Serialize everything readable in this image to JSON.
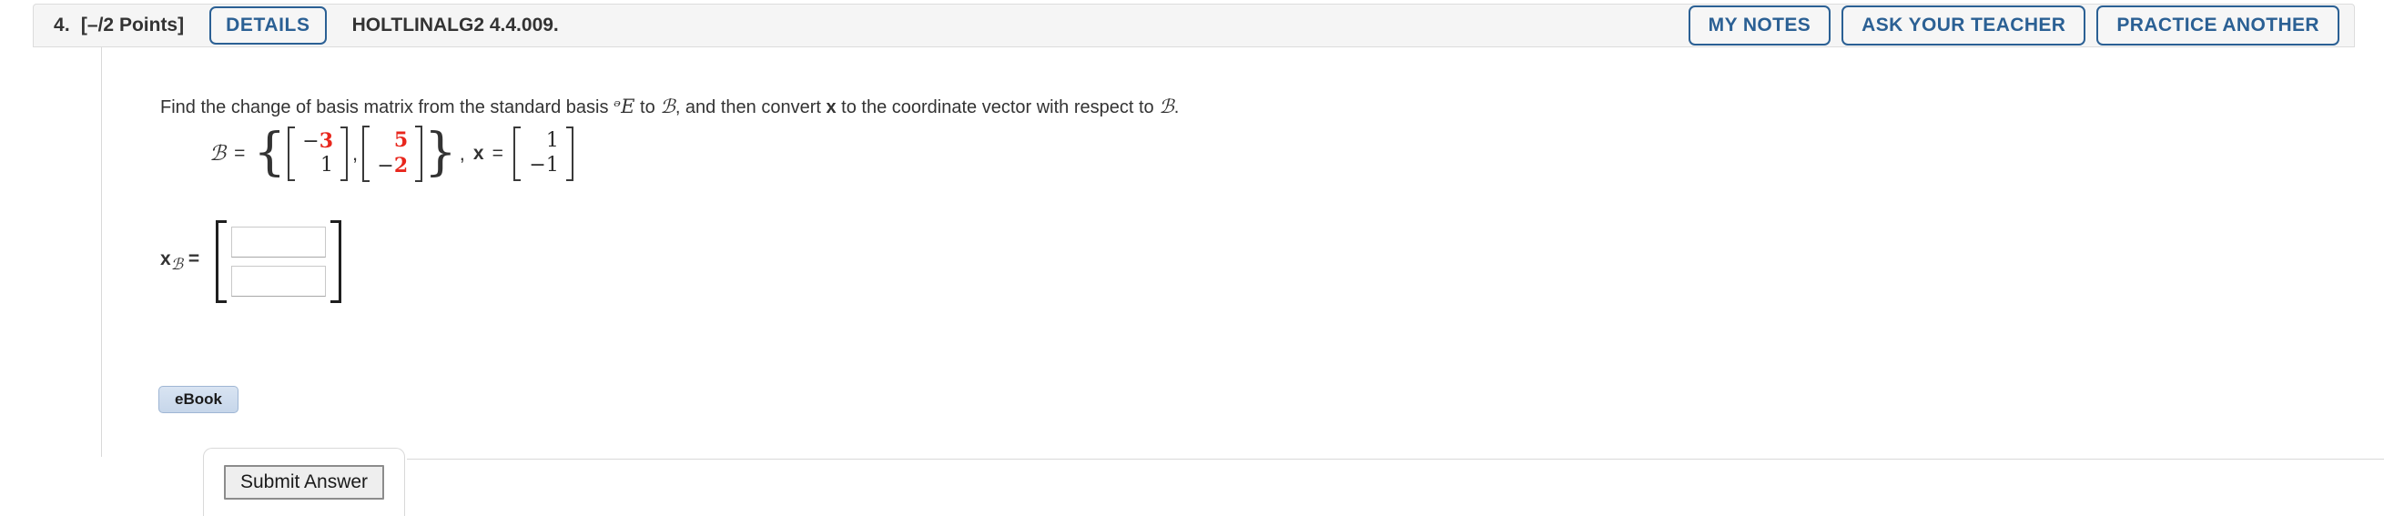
{
  "header": {
    "question_number": "4.",
    "points": "[–/2 Points]",
    "details_label": "DETAILS",
    "title": "HOLTLINALG2 4.4.009.",
    "actions": [
      {
        "label": "MY NOTES",
        "name": "my-notes-button"
      },
      {
        "label": "ASK YOUR TEACHER",
        "name": "ask-your-teacher-button"
      },
      {
        "label": "PRACTICE ANOTHER",
        "name": "practice-another-button"
      }
    ]
  },
  "question": {
    "text_part1": "Find the change of basis matrix from the standard basis ",
    "symbol_s": "ᵊE",
    "text_part2": " to ",
    "symbol_b": "ℬ",
    "text_part3": ", and then convert ",
    "symbol_x": "x",
    "text_part4": " to the coordinate vector with respect to ",
    "symbol_b2": "ℬ",
    "text_part5": "."
  },
  "math": {
    "basis_symbol": "ℬ",
    "equals": "=",
    "brace_open": "{",
    "brace_close": "}",
    "bracket_open": "[",
    "bracket_close": "]",
    "comma": ",",
    "vector1": {
      "top_sign": "−",
      "top": "3",
      "bottom_sign": "",
      "bottom": "1"
    },
    "vector2": {
      "top_sign": "",
      "top": "5",
      "bottom_sign": "−",
      "bottom": "2"
    },
    "x_symbol": "x",
    "x_vector": {
      "top_sign": "",
      "top": "1",
      "bottom_sign": "−",
      "bottom": "1"
    }
  },
  "answer": {
    "label_main": "x",
    "label_sub": "ℬ",
    "label_equals": "=",
    "field_top": "",
    "field_bottom": "",
    "placeholder": ""
  },
  "ebook": {
    "label": "eBook"
  },
  "submit": {
    "label": "Submit Answer"
  },
  "colors": {
    "accent_blue": "#2b6094",
    "value_red": "#e8261c",
    "header_bg": "#f5f5f5",
    "border_gray": "#dcdcdc"
  }
}
